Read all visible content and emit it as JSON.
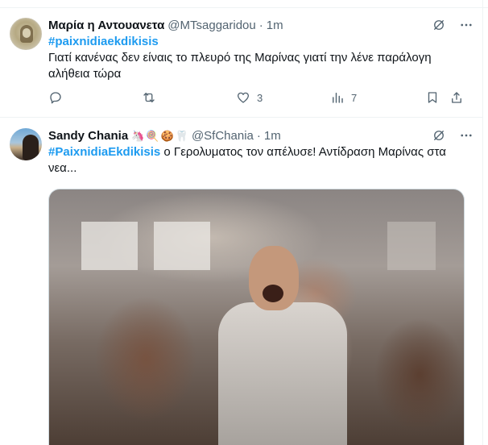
{
  "tweets": [
    {
      "name": "Μαρία η Αντουανετα",
      "handle": "@MTsaggaridou",
      "separator": "·",
      "time": "1m",
      "hashtag": "#paixnidiaekdikisis",
      "text": "Γιατί κανένας δεν είναις το πλευρό της Μαρίνας γιατί την λένε παράλογη αλήθεια τώρα",
      "counts": {
        "reply": "",
        "retweet": "",
        "like": "3",
        "views": "7"
      }
    },
    {
      "name": "Sandy Chania",
      "name_emojis": [
        "🦄",
        "🍭",
        "🍪",
        "🦷"
      ],
      "handle": "@SfChania",
      "separator": "·",
      "time": "1m",
      "hashtag": "#PaixnidiaEkdikisis",
      "text": " ο Γερολυματος τον απέλυσε! Αντίδραση Μαρίνας στα νεα..."
    }
  ],
  "colors": {
    "accent": "#1d9bf0",
    "muted": "#536471",
    "text": "#0f1419",
    "border": "#eff3f4"
  },
  "icons": [
    "grok-icon",
    "more-icon",
    "reply-icon",
    "retweet-icon",
    "like-icon",
    "views-icon",
    "bookmark-icon",
    "share-icon"
  ]
}
